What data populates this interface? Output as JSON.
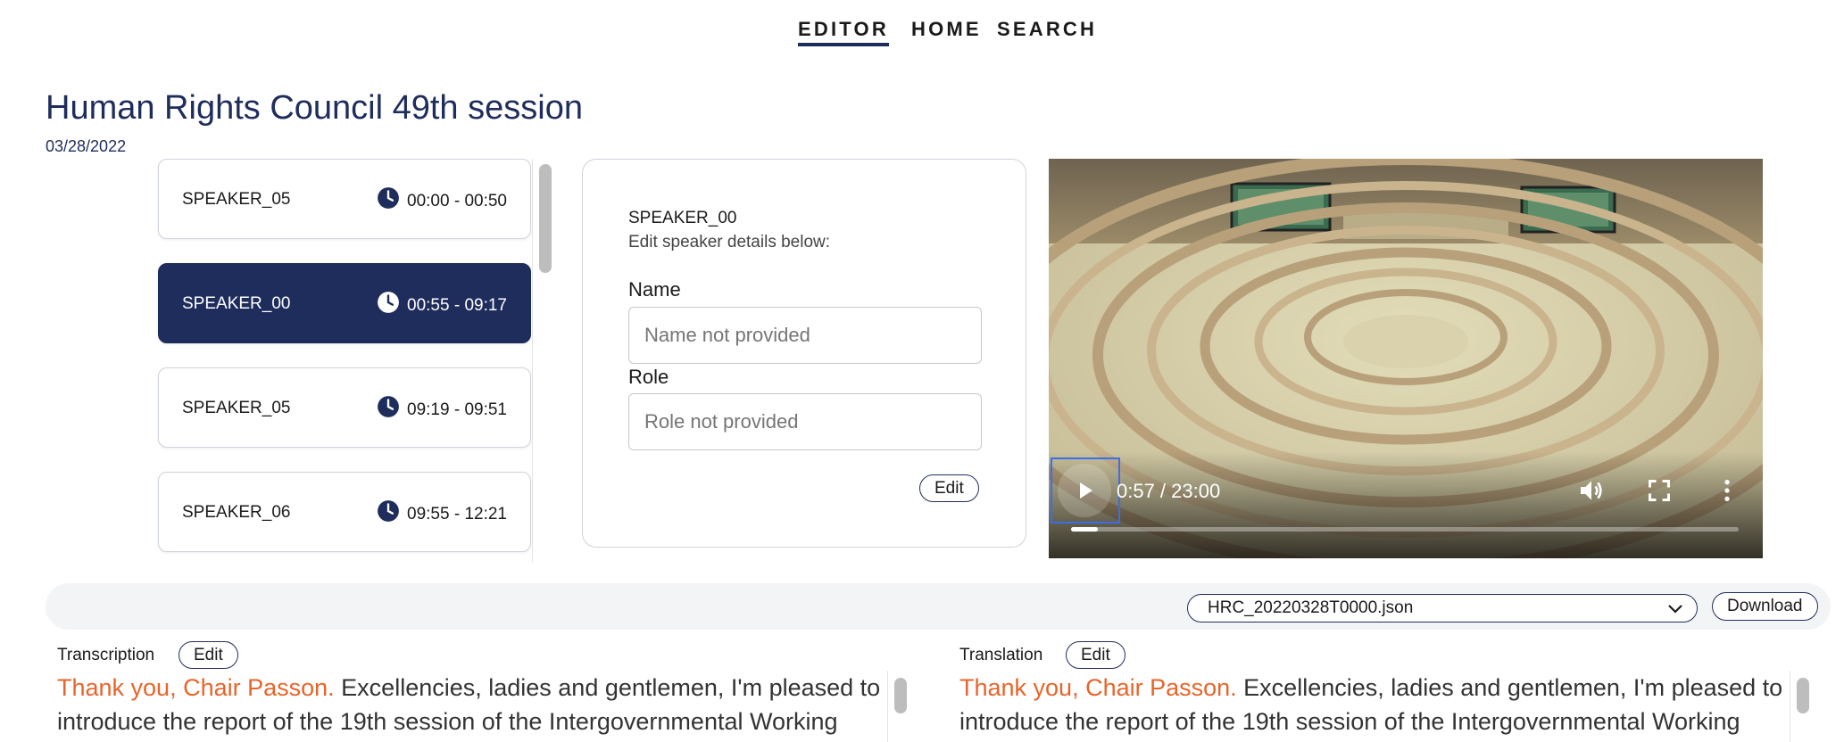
{
  "nav": {
    "editor": "EDITOR",
    "home": "HOME",
    "search": "SEARCH"
  },
  "session": {
    "title": "Human Rights Council 49th session",
    "date": "03/28/2022"
  },
  "speakers": [
    {
      "name": "SPEAKER_05",
      "time": "00:00 - 00:50",
      "selected": false
    },
    {
      "name": "SPEAKER_00",
      "time": "00:55 - 09:17",
      "selected": true
    },
    {
      "name": "SPEAKER_05",
      "time": "09:19 - 09:51",
      "selected": false
    },
    {
      "name": "SPEAKER_06",
      "time": "09:55 - 12:21",
      "selected": false
    }
  ],
  "details": {
    "speaker": "SPEAKER_00",
    "subtitle": "Edit speaker details below:",
    "name_label": "Name",
    "name_placeholder": "Name not provided",
    "role_label": "Role",
    "role_placeholder": "Role not provided",
    "edit_label": "Edit"
  },
  "video": {
    "time": "0:57 / 23:00",
    "progress": 0.04,
    "icons": [
      "play-icon",
      "volume-icon",
      "fullscreen-icon",
      "more-options-icon"
    ]
  },
  "files": {
    "selected": "HRC_20220328T0000.json",
    "download_label": "Download"
  },
  "transcription": {
    "label": "Transcription",
    "edit_label": "Edit",
    "highlight": "Thank you, Chair Passon.",
    "line1_rest": " Excellencies, ladies and gentlemen, I'm pleased to",
    "line2": "introduce the report of the 19th session of the Intergovernmental Working"
  },
  "translation": {
    "label": "Translation",
    "edit_label": "Edit",
    "highlight": "Thank you, Chair Passon.",
    "line1_rest": " Excellencies, ladies and gentlemen, I'm pleased to",
    "line2": "introduce the report of the 19th session of the Intergovernmental Working"
  },
  "colors": {
    "brand": "#1f2d5c",
    "highlight": "#e8642a"
  }
}
